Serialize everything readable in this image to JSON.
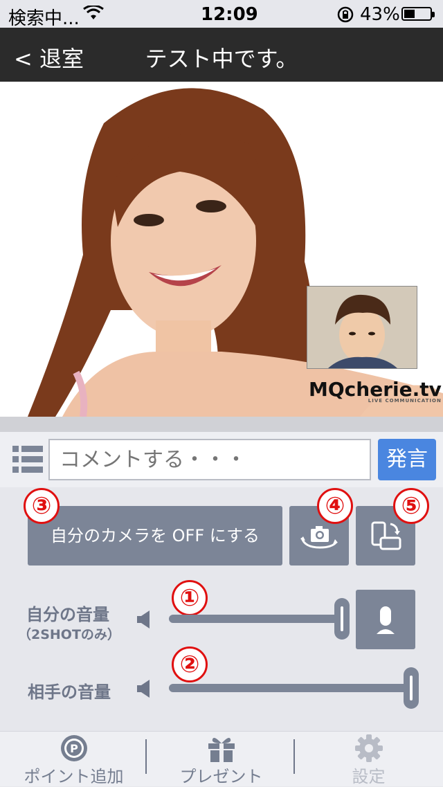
{
  "status_bar": {
    "carrier": "検索中...",
    "time": "12:09",
    "battery_percent": "43%",
    "battery_level": 0.43
  },
  "nav": {
    "back_label": "< 退室",
    "title": "テスト中です。"
  },
  "video": {
    "logo_text": "MQcherie.tv",
    "logo_subtext": "LIVE COMMUNICATION"
  },
  "comment": {
    "placeholder": "コメントする・・・",
    "send_label": "発言"
  },
  "controls": {
    "camera_off_label": "自分のカメラを OFF にする",
    "badges": [
      "③",
      "④",
      "⑤",
      "①",
      "②"
    ],
    "self_volume": {
      "label": "自分の音量",
      "sublabel": "（2SHOTのみ）",
      "value": 1.0
    },
    "partner_volume": {
      "label": "相手の音量",
      "value": 1.0
    }
  },
  "tabs": [
    {
      "label": "ポイント追加",
      "icon": "point-icon",
      "enabled": true
    },
    {
      "label": "プレゼント",
      "icon": "gift-icon",
      "enabled": true
    },
    {
      "label": "設定",
      "icon": "gear-icon",
      "enabled": false
    }
  ],
  "colors": {
    "nav_bg": "#2b2b2b",
    "send_button": "#4a86e0",
    "control_gray": "#7c8597",
    "badge_red": "#e01010"
  }
}
